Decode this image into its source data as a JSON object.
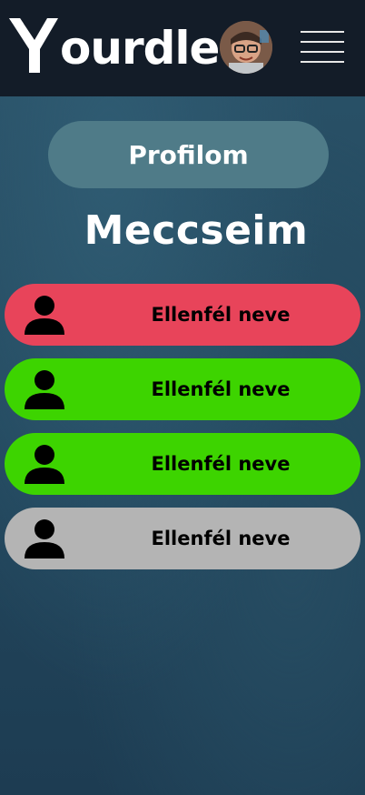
{
  "header": {
    "logo_text": "ourdle",
    "logo_alt": "Yourdle",
    "avatar_icon": "user-avatar-photo",
    "menu_icon": "hamburger-menu-icon"
  },
  "profile_button": {
    "label": "Profilom"
  },
  "title": "Meccseim",
  "matches": [
    {
      "opponent": "Ellenfél neve",
      "color": "#e8445a",
      "status": "loss"
    },
    {
      "opponent": "Ellenfél neve",
      "color": "#3dd400",
      "status": "win"
    },
    {
      "opponent": "Ellenfél neve",
      "color": "#3dd400",
      "status": "win"
    },
    {
      "opponent": "Ellenfél neve",
      "color": "#b4b4b4",
      "status": "pending"
    }
  ]
}
